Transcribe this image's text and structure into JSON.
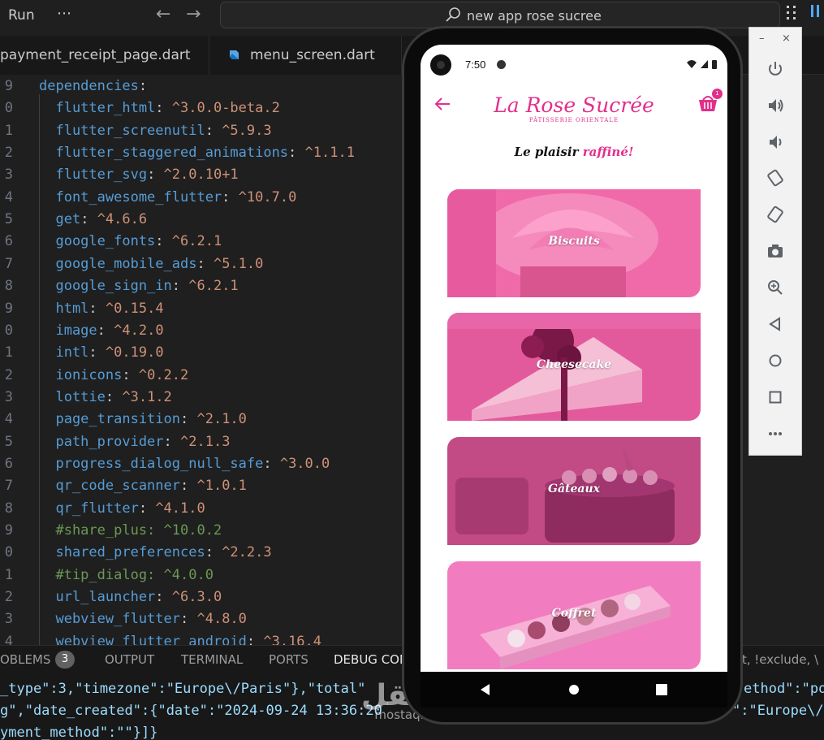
{
  "titlebar": {
    "run_label": "Run",
    "more_label": "⋯",
    "back_glyph": "←",
    "forward_glyph": "→",
    "search_text": "new app rose sucree"
  },
  "tabs": [
    {
      "label": "payment_receipt_page.dart"
    },
    {
      "label": "menu_screen.dart"
    }
  ],
  "editor": {
    "lines": [
      {
        "num": "9",
        "key": "dependencies",
        "sep": ":",
        "val": "",
        "comment": false
      },
      {
        "num": "0",
        "key": "  flutter_html",
        "sep": ": ",
        "val": "^3.0.0-beta.2",
        "comment": false
      },
      {
        "num": "1",
        "key": "  flutter_screenutil",
        "sep": ": ",
        "val": "^5.9.3",
        "comment": false
      },
      {
        "num": "2",
        "key": "  flutter_staggered_animations",
        "sep": ": ",
        "val": "^1.1.1",
        "comment": false
      },
      {
        "num": "3",
        "key": "  flutter_svg",
        "sep": ": ",
        "val": "^2.0.10+1",
        "comment": false
      },
      {
        "num": "4",
        "key": "  font_awesome_flutter",
        "sep": ": ",
        "val": "^10.7.0",
        "comment": false
      },
      {
        "num": "5",
        "key": "  get",
        "sep": ": ",
        "val": "^4.6.6",
        "comment": false
      },
      {
        "num": "6",
        "key": "  google_fonts",
        "sep": ": ",
        "val": "^6.2.1",
        "comment": false
      },
      {
        "num": "7",
        "key": "  google_mobile_ads",
        "sep": ": ",
        "val": "^5.1.0",
        "comment": false
      },
      {
        "num": "8",
        "key": "  google_sign_in",
        "sep": ": ",
        "val": "^6.2.1",
        "comment": false
      },
      {
        "num": "9",
        "key": "  html",
        "sep": ": ",
        "val": "^0.15.4",
        "comment": false
      },
      {
        "num": "0",
        "key": "  image",
        "sep": ": ",
        "val": "^4.2.0",
        "comment": false
      },
      {
        "num": "1",
        "key": "  intl",
        "sep": ": ",
        "val": "^0.19.0",
        "comment": false
      },
      {
        "num": "2",
        "key": "  ionicons",
        "sep": ": ",
        "val": "^0.2.2",
        "comment": false
      },
      {
        "num": "3",
        "key": "  lottie",
        "sep": ": ",
        "val": "^3.1.2",
        "comment": false
      },
      {
        "num": "4",
        "key": "  page_transition",
        "sep": ": ",
        "val": "^2.1.0",
        "comment": false
      },
      {
        "num": "5",
        "key": "  path_provider",
        "sep": ": ",
        "val": "^2.1.3",
        "comment": false
      },
      {
        "num": "6",
        "key": "  progress_dialog_null_safe",
        "sep": ": ",
        "val": "^3.0.0",
        "comment": false
      },
      {
        "num": "7",
        "key": "  qr_code_scanner",
        "sep": ": ",
        "val": "^1.0.1",
        "comment": false
      },
      {
        "num": "8",
        "key": "  qr_flutter",
        "sep": ": ",
        "val": "^4.1.0",
        "comment": false
      },
      {
        "num": "9",
        "key": "  #share_plus: ^10.0.2",
        "sep": "",
        "val": "",
        "comment": true
      },
      {
        "num": "0",
        "key": "  shared_preferences",
        "sep": ": ",
        "val": "^2.2.3",
        "comment": false
      },
      {
        "num": "1",
        "key": "  #tip_dialog: ^4.0.0",
        "sep": "",
        "val": "",
        "comment": true
      },
      {
        "num": "2",
        "key": "  url_launcher",
        "sep": ": ",
        "val": "^6.3.0",
        "comment": false
      },
      {
        "num": "3",
        "key": "  webview_flutter",
        "sep": ": ",
        "val": "^4.8.0",
        "comment": false
      },
      {
        "num": "4",
        "key": "  webview_flutter_android",
        "sep": ": ",
        "val": "^3.16.4",
        "comment": false
      }
    ]
  },
  "panel": {
    "tabs": [
      {
        "label": "OBLEMS"
      },
      {
        "label": "OUTPUT"
      },
      {
        "label": "TERMINAL"
      },
      {
        "label": "PORTS"
      },
      {
        "label": "DEBUG CON"
      }
    ],
    "problems_count": "3",
    "filter_text": "xt, !exclude, \\",
    "console_lines": [
      "_type\":3,\"timezone\":\"Europe\\/Paris\"},\"total\"",
      "g\",\"date_created\":{\"date\":\"2024-09-24 13:36:20",
      "yment_method\":\"\"}]}"
    ],
    "console_right": [
      "ethod\":\"po",
      "\":\"Europe\\/"
    ]
  },
  "phone": {
    "time": "7:50",
    "logo_title": "La Rose Sucrée",
    "logo_subtitle": "PÂTISSERIE ORIENTALE",
    "cart_count": "1",
    "tagline_plain": "Le plaisir ",
    "tagline_highlight": "raffiné!",
    "categories": [
      {
        "label": "Biscuits",
        "color": "#f06aa9"
      },
      {
        "label": "Cheesecake",
        "color": "#e35a9c"
      },
      {
        "label": "Gâteaux",
        "color": "#c24b86"
      },
      {
        "label": "Coffret",
        "color": "#f27cc0"
      }
    ],
    "accent_color": "#e22f8c"
  },
  "emulator": {
    "minimize_glyph": "–",
    "close_glyph": "×",
    "buttons": [
      "power-icon",
      "volume-up-icon",
      "volume-down-icon",
      "rotate-left-icon",
      "rotate-right-icon",
      "camera-icon",
      "zoom-icon",
      "back-icon",
      "home-icon",
      "overview-icon",
      "more-icon"
    ]
  },
  "watermark": {
    "arabic": "مستقل",
    "latin": "mostaql.com"
  }
}
